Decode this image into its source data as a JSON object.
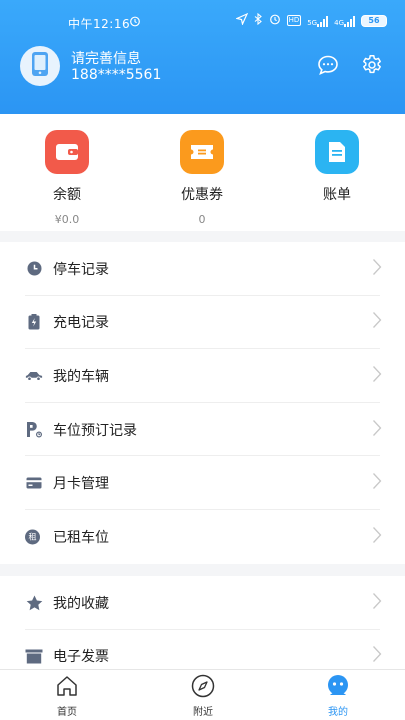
{
  "status_bar": {
    "time": "中午12:16",
    "sig1": "5G",
    "sig2": "4G",
    "hd": "HD",
    "battery": "56"
  },
  "profile": {
    "name": "请完善信息",
    "phone": "188****5561"
  },
  "wallet": [
    {
      "label": "余额",
      "value": "¥0.0",
      "icon": "wallet-icon",
      "color": "#f25a4a"
    },
    {
      "label": "优惠券",
      "value": "0",
      "icon": "coupon-icon",
      "color": "#fb9a1d"
    },
    {
      "label": "账单",
      "value": "",
      "icon": "bill-icon",
      "color": "#2bb4f2"
    }
  ],
  "menu_group1": [
    {
      "label": "停车记录",
      "icon": "clock-icon"
    },
    {
      "label": "充电记录",
      "icon": "battery-charge-icon"
    },
    {
      "label": "我的车辆",
      "icon": "car-icon"
    },
    {
      "label": "车位预订记录",
      "icon": "parking-icon"
    },
    {
      "label": "月卡管理",
      "icon": "card-icon"
    },
    {
      "label": "已租车位",
      "icon": "rent-icon",
      "glyph": "租"
    }
  ],
  "menu_group2": [
    {
      "label": "我的收藏",
      "icon": "star-icon"
    },
    {
      "label": "电子发票",
      "icon": "invoice-icon"
    }
  ],
  "tabbar": [
    {
      "label": "首页",
      "icon": "home-icon",
      "active": false
    },
    {
      "label": "附近",
      "icon": "compass-icon",
      "active": false
    },
    {
      "label": "我的",
      "icon": "profile-icon",
      "active": true
    }
  ],
  "colors": {
    "primary": "#2b95f3",
    "icon_gray": "#5e6a80"
  }
}
